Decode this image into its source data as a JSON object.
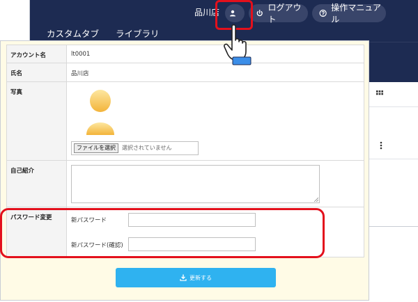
{
  "header": {
    "store_name": "品川店",
    "logout_label": "ログアウト",
    "manual_label": "操作マニュアル",
    "tabs": [
      {
        "label": "カスタムタブ",
        "active": false
      },
      {
        "label": "ライブラリ",
        "active": true
      }
    ]
  },
  "form": {
    "account_label": "アカウント名",
    "account_value": "lt0001",
    "name_label": "氏名",
    "name_value": "品川店",
    "photo_label": "写真",
    "file_button_label": "ファイルを選択",
    "file_status": "選択されていません",
    "intro_label": "自己紹介",
    "password_section_label": "パスワード変更",
    "new_password_label": "新パスワード",
    "new_password_confirm_label": "新パスワード(確認)",
    "submit_label": "更新する"
  },
  "colors": {
    "header_bg": "#1d2b52",
    "highlight": "#e3101c",
    "submit_bg": "#2fb2f0",
    "modal_bg": "#fffbe6"
  },
  "icons": [
    "user-icon",
    "power-icon",
    "help-circle-icon",
    "grid-icon",
    "kebab-icon",
    "avatar-placeholder-icon",
    "download-icon",
    "hand-pointer-icon",
    "resize-grip-icon"
  ]
}
